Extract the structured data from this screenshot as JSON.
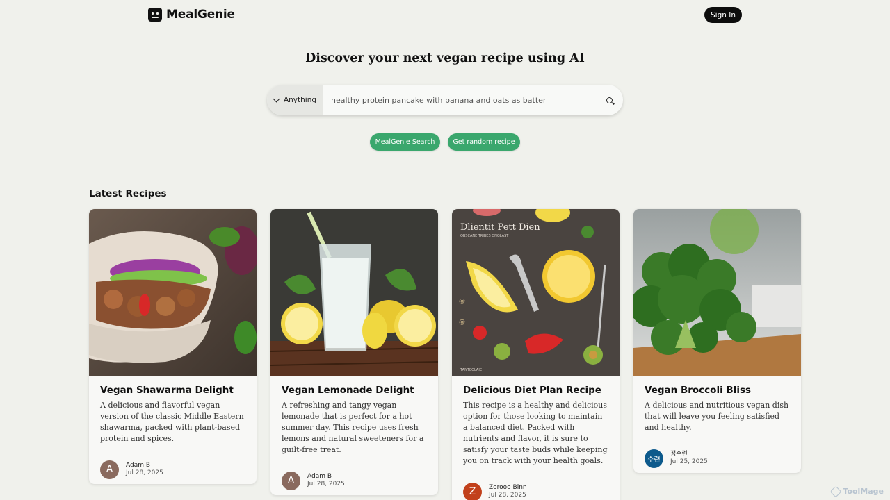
{
  "app": {
    "name": "MealGenie",
    "sign_in_label": "Sign In"
  },
  "hero": {
    "title_before": "Discover your next ",
    "title_bold": "vegan",
    "title_after": " recipe using AI"
  },
  "search": {
    "filter_label": "Anything",
    "query": "healthy protein pancake with banana and oats as batter",
    "placeholder": "healthy protein pancake with banana and oats as batter"
  },
  "actions": {
    "search_label": "MealGenie Search",
    "random_label": "Get random recipe"
  },
  "latest": {
    "heading": "Latest Recipes",
    "recipes": [
      {
        "title": "Vegan Shawarma Delight",
        "description": "A delicious and flavorful vegan version of the classic Middle Eastern shawarma, packed with plant-based protein and spices.",
        "author": "Adam B",
        "avatar_letter": "A",
        "avatar_color": "#8a6a5e",
        "date": "Jul 28, 2025"
      },
      {
        "title": "Vegan Lemonade Delight",
        "description": "A refreshing and tangy vegan lemonade that is perfect for a hot summer day. This recipe uses fresh lemons and natural sweeteners for a guilt-free treat.",
        "author": "Adam B",
        "avatar_letter": "A",
        "avatar_color": "#8a6a5e",
        "date": "Jul 28, 2025"
      },
      {
        "title": "Delicious Diet Plan Recipe",
        "description": "This recipe is a healthy and delicious option for those looking to maintain a balanced diet. Packed with nutrients and flavor, it is sure to satisfy your taste buds while keeping you on track with your health goals.",
        "image_text_top": "Dlientit Pett Dien",
        "image_text_sub": "OBSCANE TRIBES ONGLAST",
        "image_text_bottom": "TANTCOLAIC",
        "author": "Zorooo Binn",
        "avatar_letter": "Z",
        "avatar_color": "#c2411c",
        "date": "Jul 28, 2025"
      },
      {
        "title": "Vegan Broccoli Bliss",
        "description": "A delicious and nutritious vegan dish that will leave you feeling satisfied and healthy.",
        "author": "정수련",
        "avatar_letter": "수련",
        "avatar_color": "#0d5a8c",
        "date": "Jul 25, 2025"
      }
    ]
  },
  "watermark": "ToolMage"
}
